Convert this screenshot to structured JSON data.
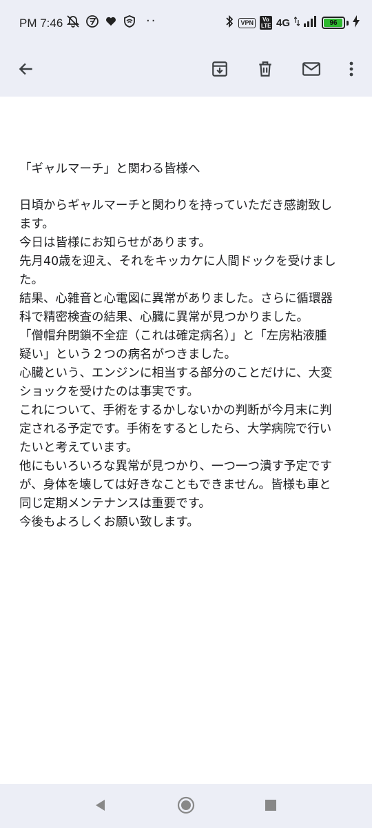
{
  "status_bar": {
    "time": "PM 7:46",
    "left_icons": [
      "alarm-off-icon",
      "sim-icon",
      "heart-icon",
      "vpn-shield-icon"
    ],
    "overflow": "··",
    "vpn": "VPN",
    "volte": "Vo LTE",
    "network": "4G",
    "battery": "96",
    "battery_level": 0.96
  },
  "toolbar": {
    "icons": [
      "back-arrow-icon",
      "archive-icon",
      "delete-icon",
      "mark-unread-icon",
      "more-vert-icon"
    ]
  },
  "email": {
    "subject": "「ギャルマーチ」と関わる皆様へ",
    "body_lines": [
      "日頃からギャルマーチと関わりを持っていただき感謝致し",
      "ます。",
      "今日は皆様にお知らせがあります。",
      "先月40歳を迎え、それをキッカケに人間ドックを受けまし",
      "た。",
      "結果、心雑音と心電図に異常がありました。さらに循環器",
      "科で精密検査の結果、心臓に異常が見つかりました。",
      "「僧帽弁閉鎖不全症（これは確定病名）」と「左房粘液腫",
      "疑い」という２つの病名がつきました。",
      "心臓という、エンジンに相当する部分のことだけに、大変",
      "ショックを受けたのは事実です。",
      "これについて、手術をするかしないかの判断が今月末に判",
      "定される予定です。手術をするとしたら、大学病院で行い",
      "たいと考えています。",
      "他にもいろいろな異常が見つかり、一つ一つ潰す予定です",
      "が、身体を壊しては好きなこともできません。皆様も車と",
      "同じ定期メンテナンスは重要です。",
      "今後もよろしくお願い致します。"
    ]
  },
  "nav_bar": {
    "items": [
      "back-triangle-icon",
      "home-circle-icon",
      "recents-square-icon"
    ]
  }
}
